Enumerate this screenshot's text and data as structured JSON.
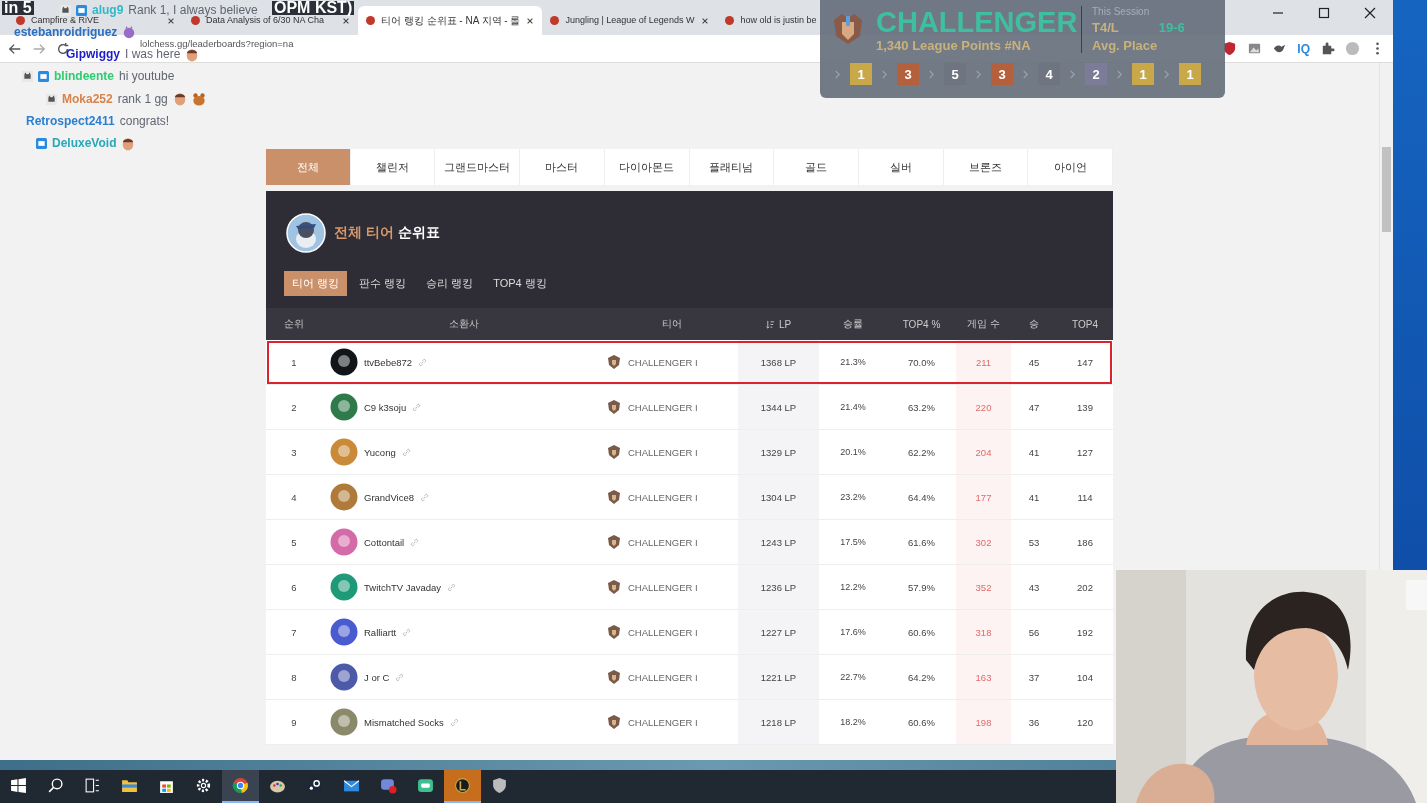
{
  "stream_title_fragments": [
    "in 5",
    "OPM KST)"
  ],
  "browser": {
    "tabs": [
      {
        "title": "Campfire & RiVE",
        "selected": false
      },
      {
        "title": "Data Analysis of 6/30 NA Cha",
        "selected": false
      },
      {
        "title": "티어 랭킹 순위표 - NA 지역 - 롤",
        "selected": true
      },
      {
        "title": "Jungling | League of Legends W",
        "selected": false
      },
      {
        "title": "how old is justin be",
        "selected": false
      }
    ],
    "address": "lolchess.gg/leaderboards?region=na",
    "extension_label": "IQ"
  },
  "chat": [
    {
      "user": "alug9",
      "color": "#2fb8c8",
      "badges": [
        {
          "kind": "cat"
        },
        {
          "kind": "broadcast"
        }
      ],
      "message": "Rank 1, I always believe"
    },
    {
      "user": "estebanroidriguez",
      "color": "#2a6fc0",
      "emotes": [
        {
          "kind": "creature"
        }
      ]
    },
    {
      "user": "Gipwiggy",
      "color": "#1c1ccc",
      "message": "I was here",
      "emotes": [
        {
          "kind": "face"
        }
      ]
    },
    {
      "user": "blindeente",
      "color": "#2ecc71",
      "badges": [
        {
          "kind": "cat"
        },
        {
          "kind": "broadcast"
        }
      ],
      "message": "hi youtube"
    },
    {
      "user": "Moka252",
      "color": "#d9824a",
      "badges": [
        {
          "kind": "cat"
        }
      ],
      "message": "rank 1 gg",
      "emotes": [
        {
          "kind": "face"
        },
        {
          "kind": "bear"
        }
      ]
    },
    {
      "user": "Retrospect2411",
      "color": "#2a7fd0",
      "message": "congrats!"
    },
    {
      "user": "DeluxeVoid",
      "color": "#28a7b8",
      "badges": [
        {
          "kind": "broadcast"
        }
      ],
      "emotes": [
        {
          "kind": "face"
        }
      ]
    }
  ],
  "rank_overlay": {
    "tier": "CHALLENGER",
    "points": "1,340 League Points #NA",
    "session_label": "This Session",
    "record_label": "T4/L",
    "record_value": "19-6",
    "avg_label": "Avg. Place",
    "placements": [
      {
        "value": "1",
        "color": "#c9a84a"
      },
      {
        "value": "3",
        "color": "#b5603c"
      },
      {
        "value": "5",
        "color": "#6f7580"
      },
      {
        "value": "3",
        "color": "#b5603c"
      },
      {
        "value": "4",
        "color": "#6f7580"
      },
      {
        "value": "2",
        "color": "#7d7c98"
      },
      {
        "value": "1",
        "color": "#c9a84a"
      },
      {
        "value": "1",
        "color": "#c9a84a"
      }
    ]
  },
  "tier_tabs": [
    {
      "label": "전체",
      "selected": true
    },
    {
      "label": "챌린저",
      "selected": false
    },
    {
      "label": "그랜드마스터",
      "selected": false
    },
    {
      "label": "마스터",
      "selected": false
    },
    {
      "label": "다이아몬드",
      "selected": false
    },
    {
      "label": "플래티넘",
      "selected": false
    },
    {
      "label": "골드",
      "selected": false
    },
    {
      "label": "실버",
      "selected": false
    },
    {
      "label": "브론즈",
      "selected": false
    },
    {
      "label": "아이언",
      "selected": false
    }
  ],
  "panel": {
    "title_highlight": "전체 티어",
    "title_rest": "순위표",
    "ranking_tabs": [
      {
        "label": "티어 랭킹",
        "selected": true
      },
      {
        "label": "판수 랭킹",
        "selected": false
      },
      {
        "label": "승리 랭킹",
        "selected": false
      },
      {
        "label": "TOP4 랭킹",
        "selected": false
      }
    ]
  },
  "table": {
    "columns": [
      "순위",
      "소환사",
      "티어",
      "LP",
      "승률",
      "TOP4 %",
      "게임 수",
      "승",
      "TOP4"
    ],
    "rows": [
      {
        "rank": "1",
        "name": "ttvBebe872",
        "tier": "CHALLENGER I",
        "lp": "1368 LP",
        "win_rate": "21.3%",
        "top4_rate": "70.0%",
        "games": "211",
        "wins": "45",
        "top4": "147",
        "selected": true
      },
      {
        "rank": "2",
        "name": "C9 k3soju",
        "tier": "CHALLENGER I",
        "lp": "1344 LP",
        "win_rate": "21.4%",
        "top4_rate": "63.2%",
        "games": "220",
        "wins": "47",
        "top4": "139",
        "selected": false
      },
      {
        "rank": "3",
        "name": "Yucong",
        "tier": "CHALLENGER I",
        "lp": "1329 LP",
        "win_rate": "20.1%",
        "top4_rate": "62.2%",
        "games": "204",
        "wins": "41",
        "top4": "127",
        "selected": false
      },
      {
        "rank": "4",
        "name": "GrandVice8",
        "tier": "CHALLENGER I",
        "lp": "1304 LP",
        "win_rate": "23.2%",
        "top4_rate": "64.4%",
        "games": "177",
        "wins": "41",
        "top4": "114",
        "selected": false
      },
      {
        "rank": "5",
        "name": "Cottontail",
        "tier": "CHALLENGER I",
        "lp": "1243 LP",
        "win_rate": "17.5%",
        "top4_rate": "61.6%",
        "games": "302",
        "wins": "53",
        "top4": "186",
        "selected": false
      },
      {
        "rank": "6",
        "name": "TwitchTV Javaday",
        "tier": "CHALLENGER I",
        "lp": "1236 LP",
        "win_rate": "12.2%",
        "top4_rate": "57.9%",
        "games": "352",
        "wins": "43",
        "top4": "202",
        "selected": false
      },
      {
        "rank": "7",
        "name": "Ralliartt",
        "tier": "CHALLENGER I",
        "lp": "1227 LP",
        "win_rate": "17.6%",
        "top4_rate": "60.6%",
        "games": "318",
        "wins": "56",
        "top4": "192",
        "selected": false
      },
      {
        "rank": "8",
        "name": "J or C",
        "tier": "CHALLENGER I",
        "lp": "1221 LP",
        "win_rate": "22.7%",
        "top4_rate": "64.2%",
        "games": "163",
        "wins": "37",
        "top4": "104",
        "selected": false
      },
      {
        "rank": "9",
        "name": "Mismatched Socks",
        "tier": "CHALLENGER I",
        "lp": "1218 LP",
        "win_rate": "18.2%",
        "top4_rate": "60.6%",
        "games": "198",
        "wins": "36",
        "top4": "120",
        "selected": false
      }
    ]
  },
  "taskbar": [
    {
      "kind": "windows",
      "active": false
    },
    {
      "kind": "search",
      "active": false
    },
    {
      "kind": "taskview",
      "active": false
    },
    {
      "kind": "folder",
      "active": false
    },
    {
      "kind": "store",
      "active": false
    },
    {
      "kind": "gear",
      "active": false
    },
    {
      "kind": "browser",
      "active": true
    },
    {
      "kind": "palette",
      "active": false
    },
    {
      "kind": "disc",
      "active": false
    },
    {
      "kind": "mail",
      "active": false
    },
    {
      "kind": "chatapp",
      "active": false
    },
    {
      "kind": "message",
      "active": false
    },
    {
      "kind": "game",
      "active": true
    },
    {
      "kind": "shield",
      "active": false
    }
  ]
}
